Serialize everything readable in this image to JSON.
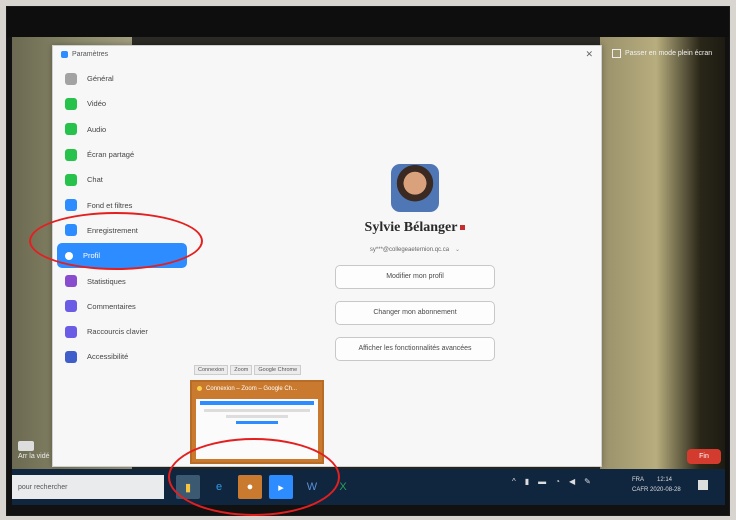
{
  "window": {
    "title": "Paramètres"
  },
  "sidebar": {
    "items": [
      {
        "label": "Général",
        "color": "#a3a3a3"
      },
      {
        "label": "Vidéo",
        "color": "#27c24c"
      },
      {
        "label": "Audio",
        "color": "#27c24c"
      },
      {
        "label": "Écran partagé",
        "color": "#27c24c"
      },
      {
        "label": "Chat",
        "color": "#27c24c"
      },
      {
        "label": "Fond et filtres",
        "color": "#2d8cff"
      },
      {
        "label": "Enregistrement",
        "color": "#2d8cff"
      },
      {
        "label": "Profil",
        "color": "#2d8cff",
        "selected": true
      },
      {
        "label": "Statistiques",
        "color": "#8a4ccf"
      },
      {
        "label": "Commentaires",
        "color": "#6b5ce6"
      },
      {
        "label": "Raccourcis clavier",
        "color": "#6b5ce6"
      },
      {
        "label": "Accessibilité",
        "color": "#3f5ec9"
      }
    ]
  },
  "profile": {
    "name": "Sylvie Bélanger",
    "email": "sy***@collegeaeternion.qc.ca",
    "edit_label": "Modifier mon profil",
    "subscription_label": "Changer mon abonnement",
    "features_label": "Afficher les fonctionnalités avancées"
  },
  "video": {
    "fullscreen_label": "Passer en mode plein écran",
    "stop_video_label": "Arr la vidé",
    "end_label": "Fin"
  },
  "preview": {
    "tabs": [
      "Connexion",
      "Zoom",
      "Google Chrome"
    ],
    "title": "Connexion – Zoom – Google Ch..."
  },
  "taskbar": {
    "search_placeholder": "pour rechercher",
    "language": "FRA",
    "region": "CAFR",
    "time": "12:14",
    "date": "2020-08-28"
  },
  "annotations": {
    "color": "#e41f1f"
  }
}
